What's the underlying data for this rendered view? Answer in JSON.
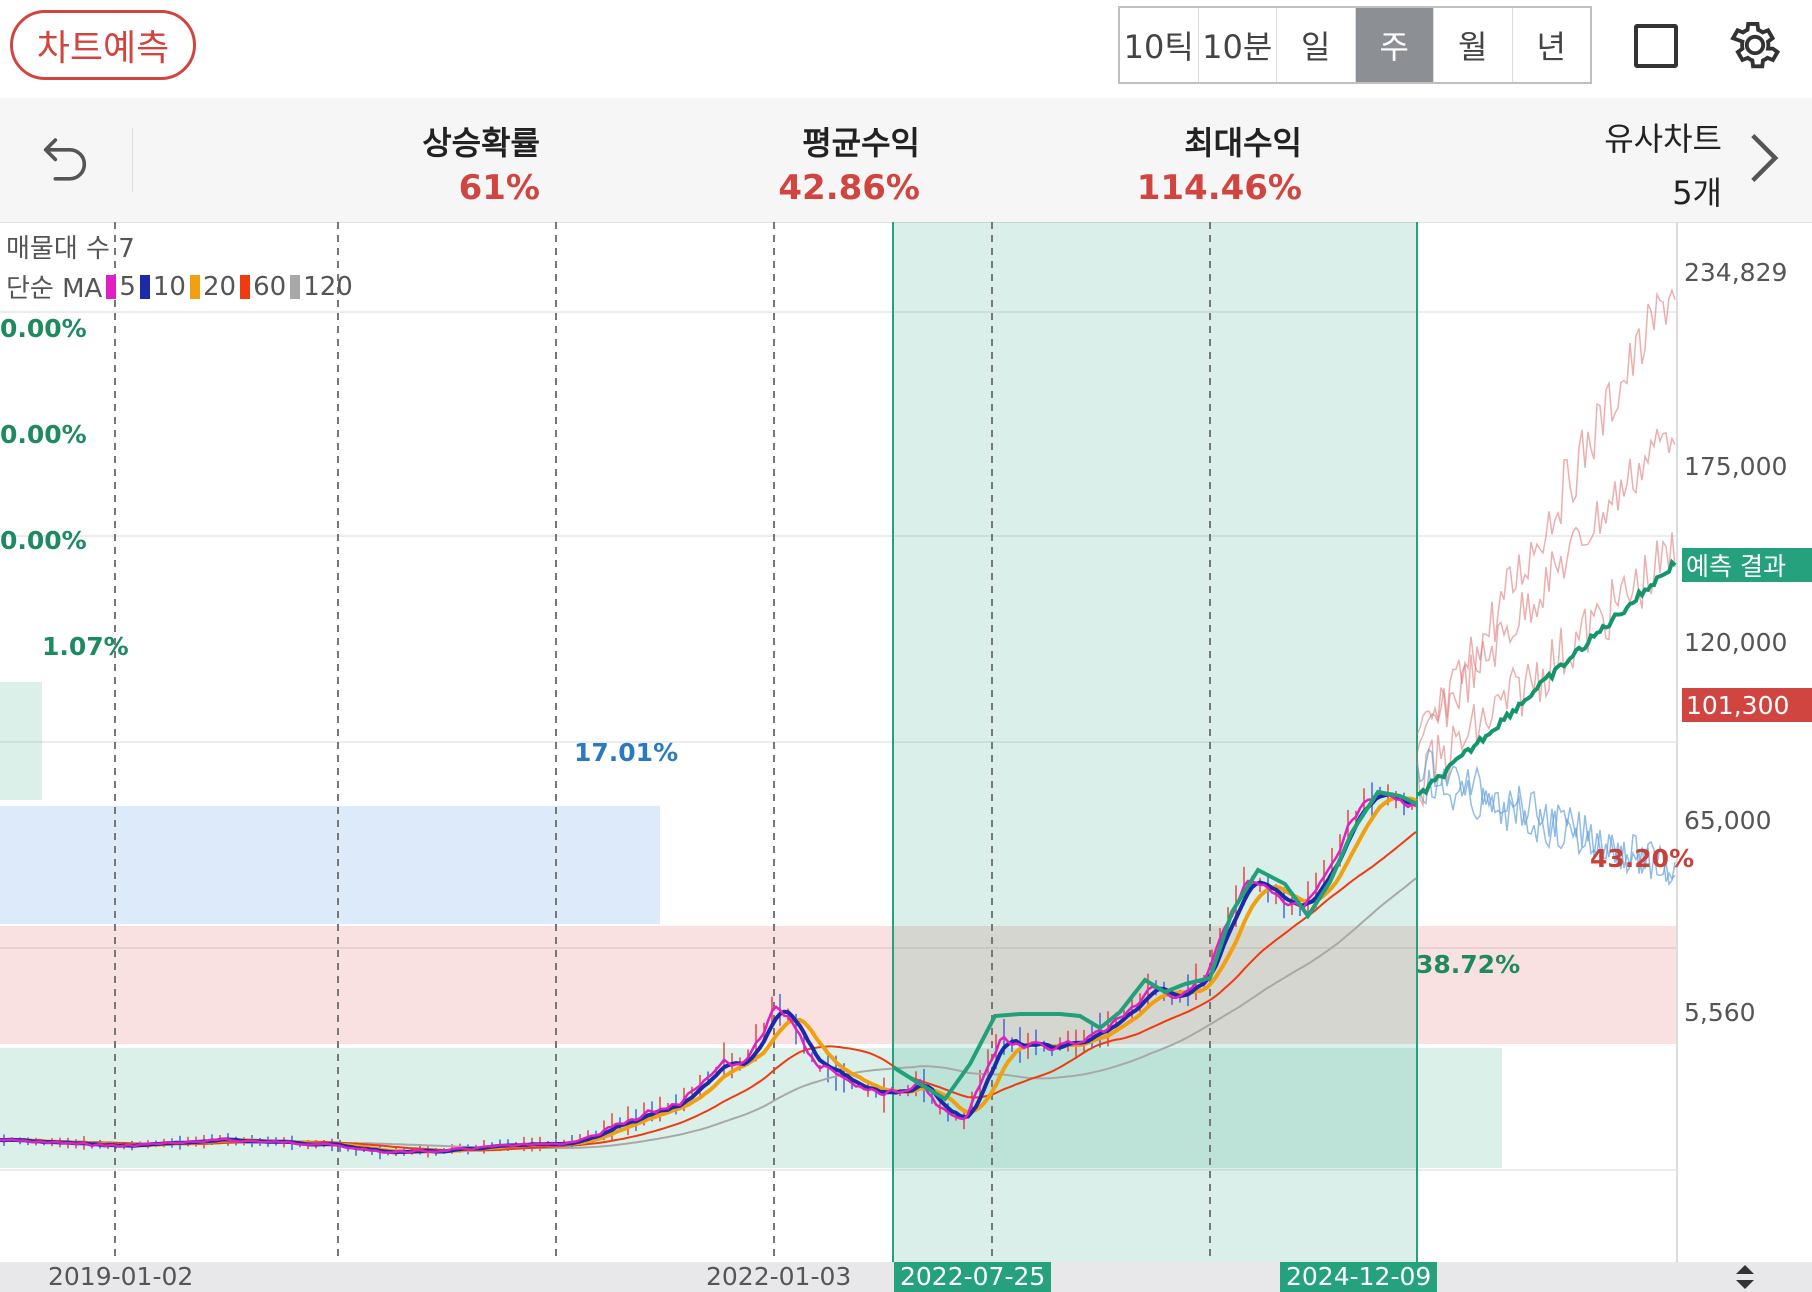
{
  "toolbar": {
    "predict_label": "차트예측",
    "periods": [
      "10틱",
      "10분",
      "일",
      "주",
      "월",
      "년"
    ],
    "active_period": "주",
    "square_icon": "square-icon",
    "settings_icon": "gear-icon"
  },
  "stats": {
    "undo_icon": "undo-icon",
    "rise_prob": {
      "label": "상승확률",
      "value": "61%"
    },
    "avg_return": {
      "label": "평균수익",
      "value": "42.86%"
    },
    "max_return": {
      "label": "최대수익",
      "value": "114.46%"
    },
    "similar": {
      "label": "유사차트",
      "value": "5개"
    },
    "chevron_icon": "chevron-right-icon"
  },
  "legend": {
    "volume_profile": "매물대 수 7",
    "ma_prefix": "단순 MA",
    "ma": [
      {
        "period": "5",
        "color": "#e020c0"
      },
      {
        "period": "10",
        "color": "#1a2aa8"
      },
      {
        "period": "20",
        "color": "#f0a010"
      },
      {
        "period": "60",
        "color": "#f03a10"
      },
      {
        "period": "120",
        "color": "#a8a8a8"
      }
    ]
  },
  "yaxis": {
    "ticks": [
      "234,829",
      "175,000",
      "120,000",
      "65,000",
      "5,560"
    ],
    "current_price": "101,300",
    "current_price_color": "#d0453f",
    "prediction_tag": "예측 결과",
    "prediction_color": "#26a17e"
  },
  "volume_profile": [
    {
      "label": "0.00%",
      "color": "#1f8a5f"
    },
    {
      "label": "0.00%",
      "color": "#1f8a5f"
    },
    {
      "label": "0.00%",
      "color": "#1f8a5f"
    },
    {
      "label": "1.07%",
      "color": "#1f8a5f"
    },
    {
      "label": "17.01%",
      "color": "#2a7ac0"
    },
    {
      "label": "43.20%",
      "color": "#c8403a"
    },
    {
      "label": "38.72%",
      "color": "#1f8a5f"
    }
  ],
  "xaxis": {
    "labels": [
      "2019-01-02",
      "2022-01-03"
    ],
    "range_start": "2022-07-25",
    "range_end": "2024-12-09"
  }
}
